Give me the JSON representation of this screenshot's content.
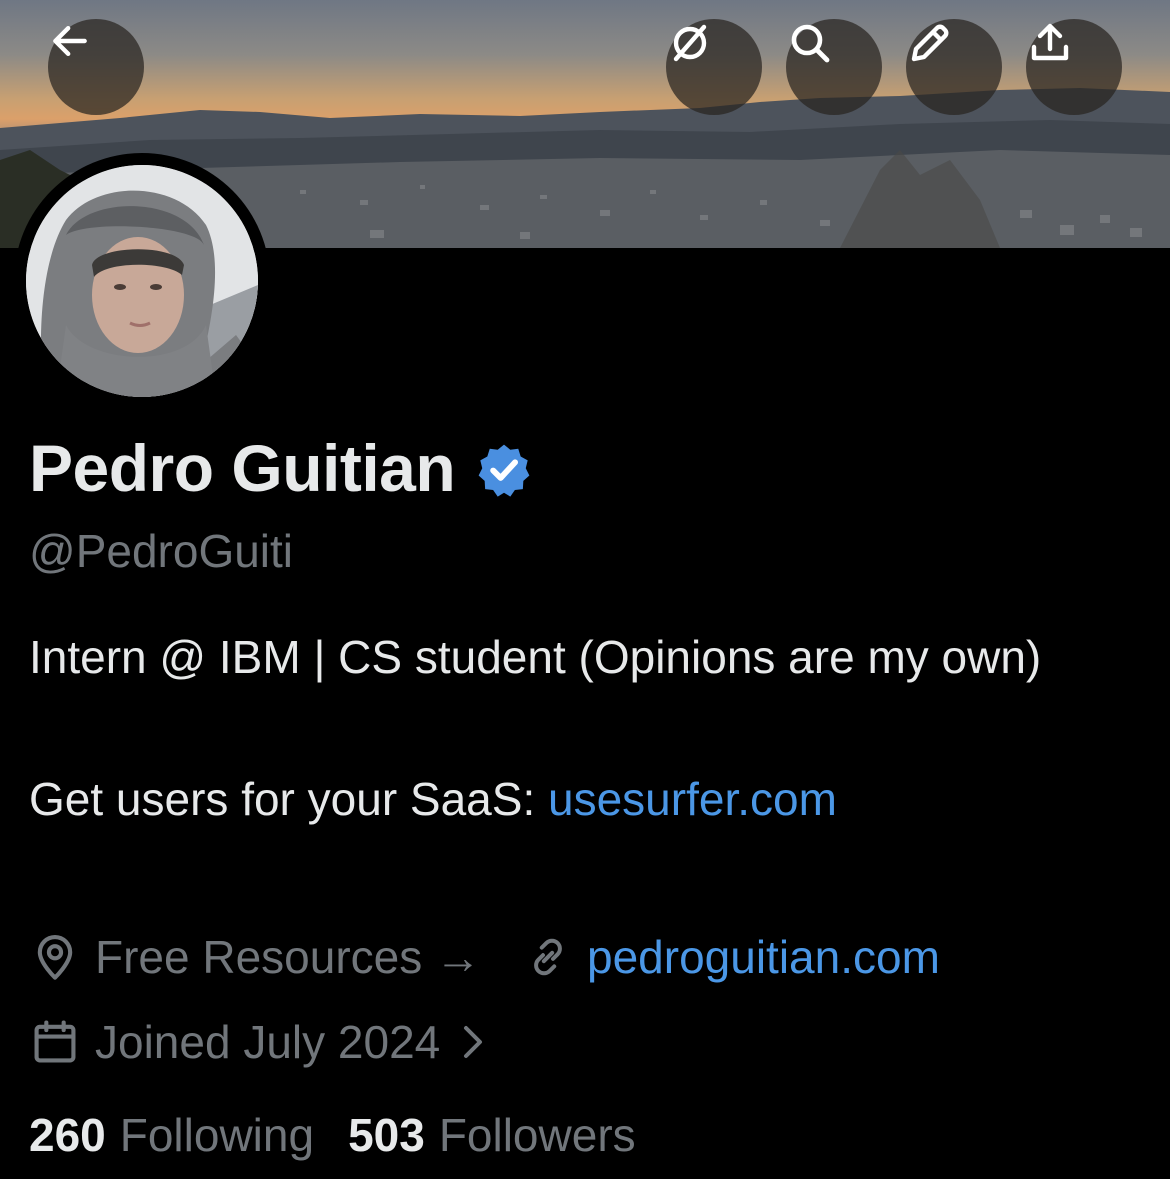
{
  "header": {
    "back_icon": "arrow-left-icon",
    "actions": [
      "translate-off-icon",
      "search-icon",
      "pencil-icon",
      "share-icon"
    ]
  },
  "profile": {
    "name": "Pedro Guitian",
    "verified": true,
    "handle": "@PedroGuiti",
    "bio_line1": "Intern @ IBM | CS student (Opinions are my own)",
    "bio_line2_prefix": "Get users for your SaaS: ",
    "bio_line2_link": "usesurfer.com",
    "location": "Free Resources →",
    "website": "pedroguitian.com",
    "joined": "Joined July 2024",
    "following_count": "260",
    "following_label": "Following",
    "followers_count": "503",
    "followers_label": "Followers"
  },
  "colors": {
    "background": "#000000",
    "text": "#e7e9ea",
    "muted": "#71767b",
    "link": "#4b97e6",
    "verified": "#4a8fe0"
  }
}
